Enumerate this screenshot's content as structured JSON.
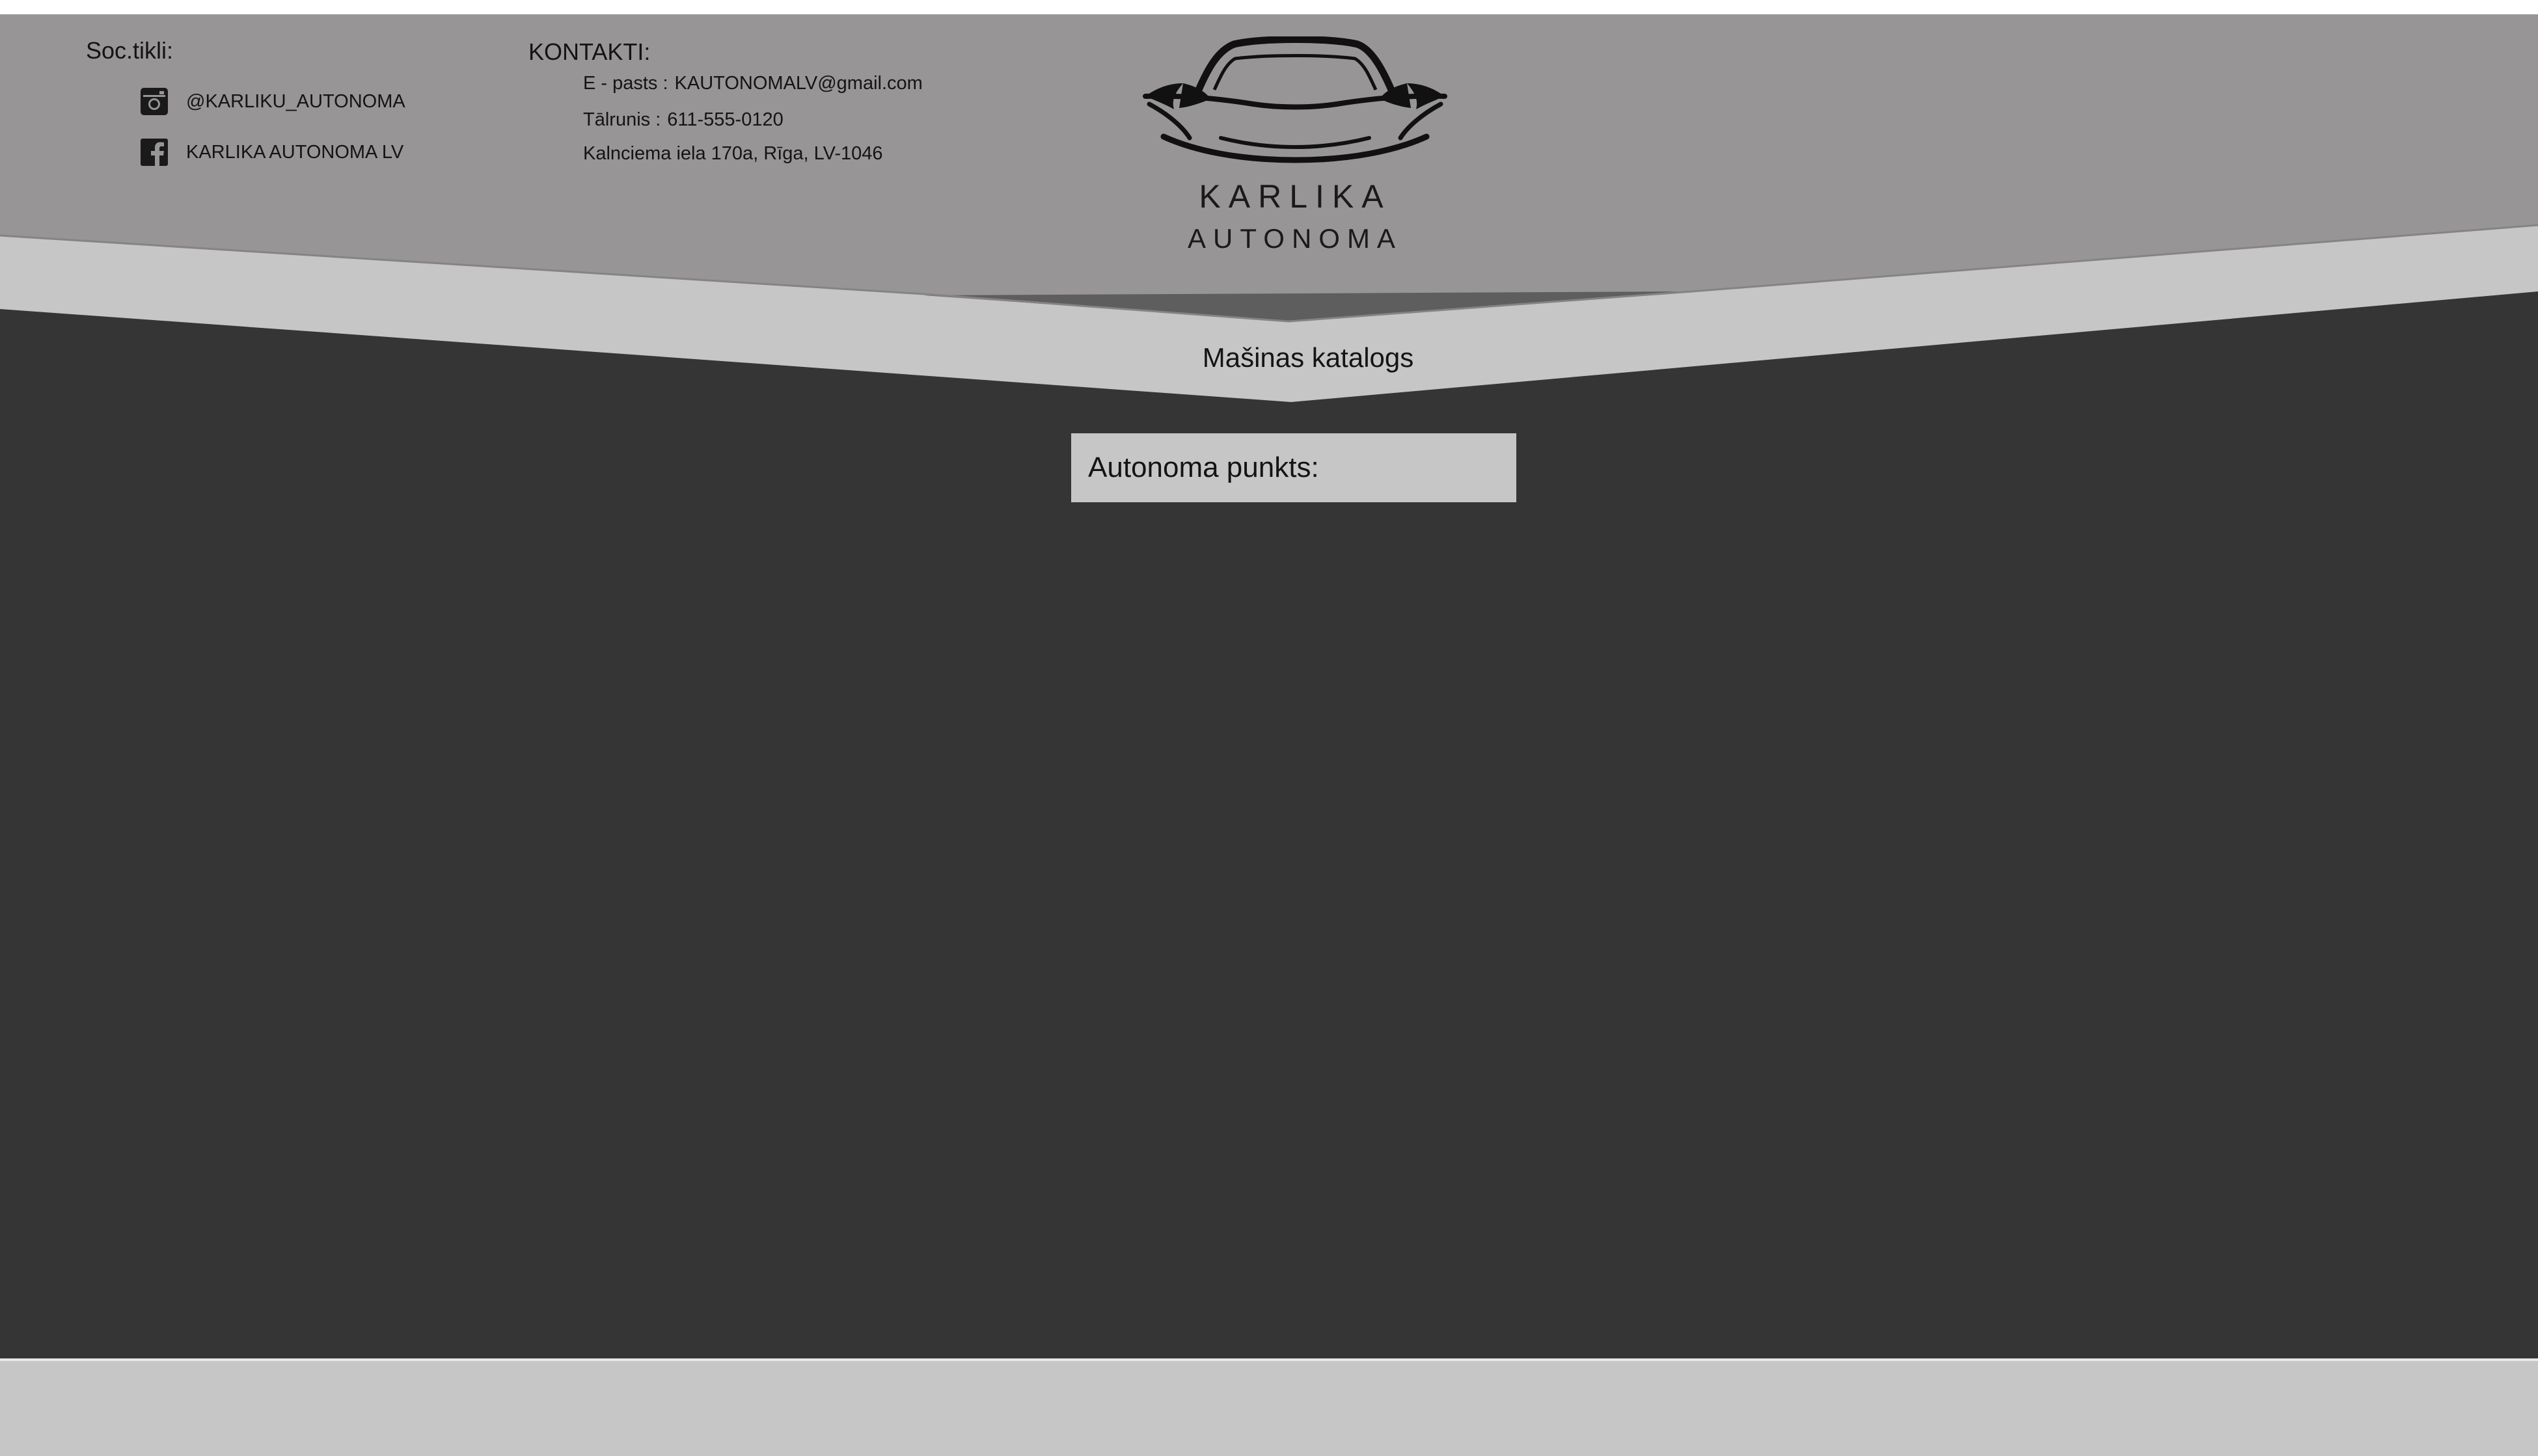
{
  "colors": {
    "header_bg": "#979596",
    "band_bg": "#c6c6c6",
    "main_bg": "#353535",
    "footer_bg": "#c6c6c6",
    "accent_dark": "#5f5e5f",
    "text": "#141414"
  },
  "social": {
    "title": "Soc.tikli:",
    "items": [
      {
        "icon": "instagram-icon",
        "label": "@KARLIKU_AUTONOMA"
      },
      {
        "icon": "facebook-icon",
        "label": "KARLIKA AUTONOMA LV"
      }
    ]
  },
  "contacts": {
    "title": "KONTAKTI:",
    "email_label": "E - pasts  :",
    "email_value": "KAUTONOMALV@gmail.com",
    "phone_label": "Tālrunis :",
    "phone_value": "611-555-0120",
    "address": "Kalnciema iela 170a, Rīga, LV-1046"
  },
  "logo": {
    "icon": "car-logo-icon",
    "line1": "KARLIKA",
    "line2": "AUTONOMA"
  },
  "nav": {
    "catalog_label": "Mašinas katalogs"
  },
  "main": {
    "punkts_label": "Autonoma punkts:"
  }
}
